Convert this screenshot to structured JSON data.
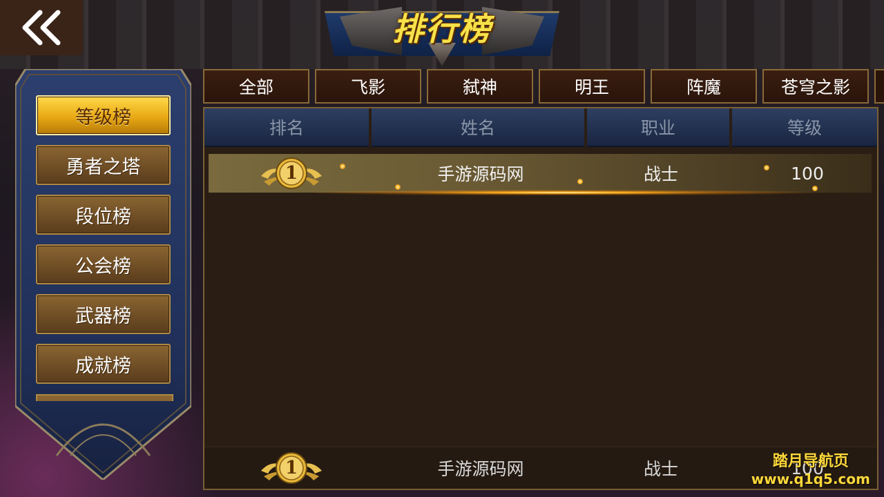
{
  "title": "排行榜",
  "back_label": "back",
  "sidebar": {
    "items": [
      {
        "label": "等级榜",
        "active": true
      },
      {
        "label": "勇者之塔",
        "active": false
      },
      {
        "label": "段位榜",
        "active": false
      },
      {
        "label": "公会榜",
        "active": false
      },
      {
        "label": "武器榜",
        "active": false
      },
      {
        "label": "成就榜",
        "active": false
      }
    ]
  },
  "tabs": [
    "全部",
    "飞影",
    "弑神",
    "明王",
    "阵魔",
    "苍穹之影"
  ],
  "table": {
    "headers": [
      "排名",
      "姓名",
      "职业",
      "等级"
    ],
    "rows": [
      {
        "rank": "1",
        "name": "手游源码网",
        "class": "战士",
        "level": "100"
      }
    ]
  },
  "self_row": {
    "rank": "1",
    "name": "手游源码网",
    "class": "战士",
    "level": "100"
  },
  "watermark": {
    "line1": "踏月导航页",
    "line2": "www.q1q5.com"
  },
  "colors": {
    "gold": "#f6e24a",
    "panel": "#2a1e14",
    "header_blue": "#2d3f62",
    "active_btn": "#e8a914"
  }
}
